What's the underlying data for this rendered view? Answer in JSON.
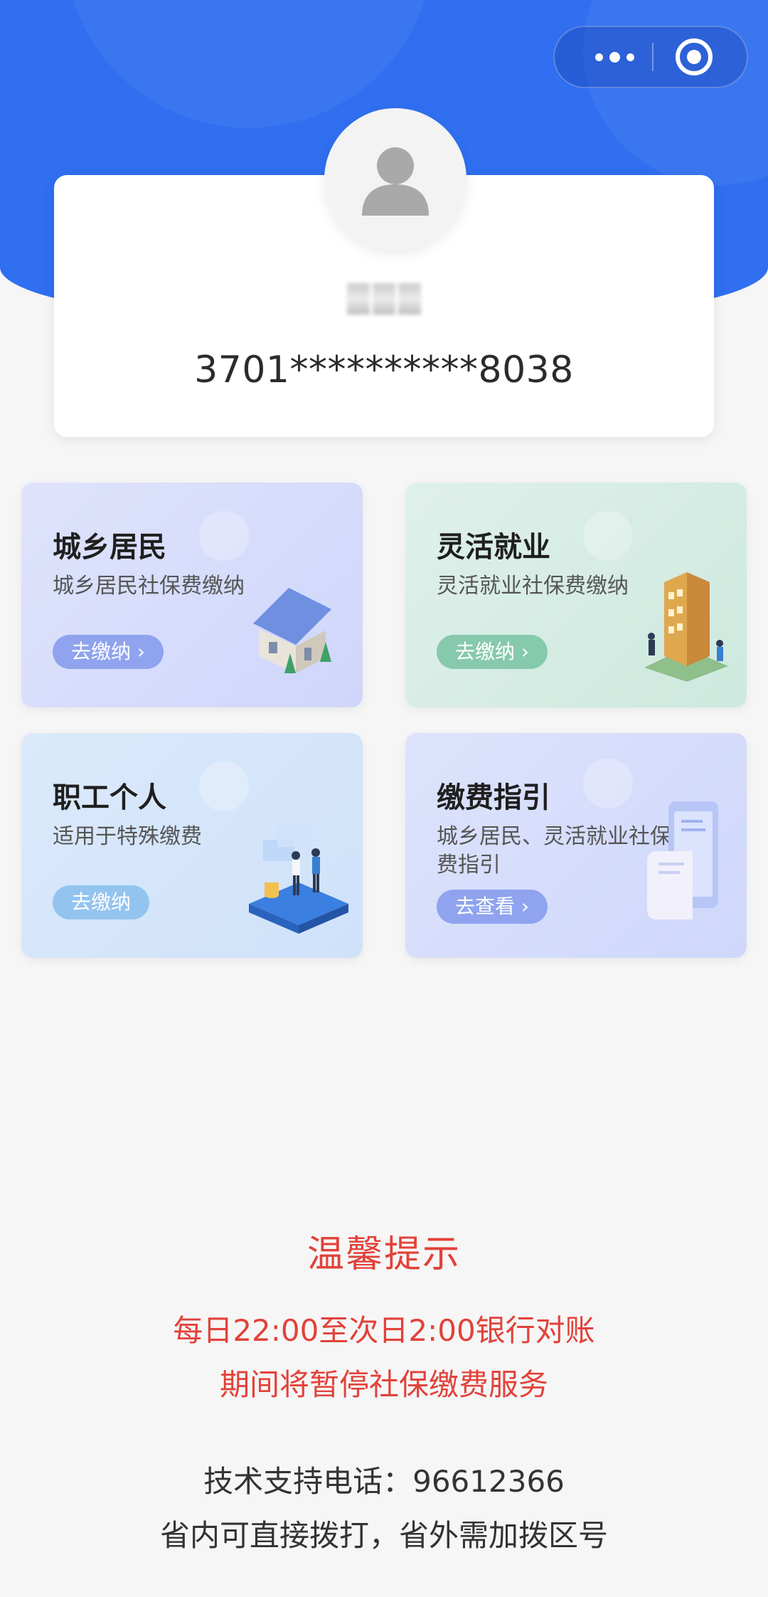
{
  "header": {
    "menu_icon": "more-dots-icon",
    "close_icon": "target-circle-icon"
  },
  "profile": {
    "avatar_icon": "user-silhouette-icon",
    "name_masked": "",
    "id_number": "3701**********8038"
  },
  "services": [
    {
      "title": "城乡居民",
      "subtitle": "城乡居民社保费缴纳",
      "button": "去缴纳",
      "illustration": "house-icon"
    },
    {
      "title": "灵活就业",
      "subtitle": "灵活就业社保费缴纳",
      "button": "去缴纳",
      "illustration": "building-icon"
    },
    {
      "title": "职工个人",
      "subtitle": "适用于特殊缴费",
      "button": "去缴纳",
      "illustration": "workers-icon"
    },
    {
      "title": "缴费指引",
      "subtitle": "城乡居民、灵活就业社保费指引",
      "button": "去查看",
      "illustration": "document-phone-icon"
    }
  ],
  "notice": {
    "title": "温馨提示",
    "line1": "每日22:00至次日2:00银行对账",
    "line2": "期间将暂停社保缴费服务"
  },
  "support": {
    "phone_line": "技术支持电话：96612366",
    "dial_note": "省内可直接拨打，省外需加拨区号"
  }
}
